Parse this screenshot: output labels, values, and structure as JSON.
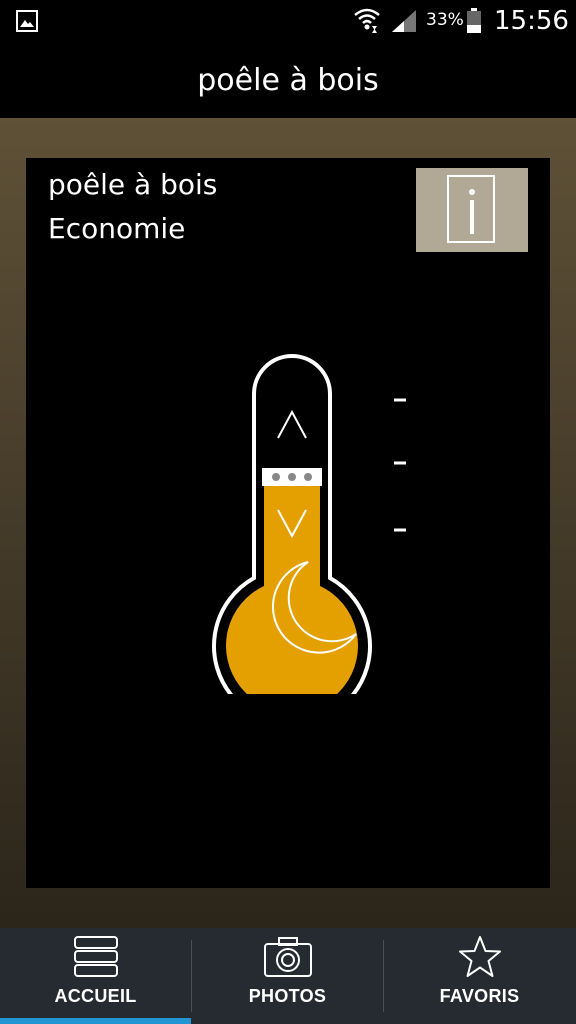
{
  "status_bar": {
    "battery_percent": "33%",
    "time": "15:56",
    "icons": [
      "gallery-icon",
      "wifi-icon",
      "signal-icon",
      "battery-icon"
    ]
  },
  "header": {
    "title": "poêle à bois"
  },
  "device": {
    "name": "poêle à bois",
    "mode": "Economie",
    "info_icon": "info-icon",
    "mode_icon": "moon-icon",
    "colors": {
      "mercury": "#e4a000",
      "info_button": "#b1a895",
      "card_bg": "#000000"
    }
  },
  "nav": {
    "tabs": [
      {
        "label": "ACCUEIL",
        "icon": "stack-icon",
        "active": true
      },
      {
        "label": "PHOTOS",
        "icon": "camera-icon",
        "active": false
      },
      {
        "label": "FAVORIS",
        "icon": "star-icon",
        "active": false
      }
    ],
    "accent_color": "#2196d3"
  }
}
